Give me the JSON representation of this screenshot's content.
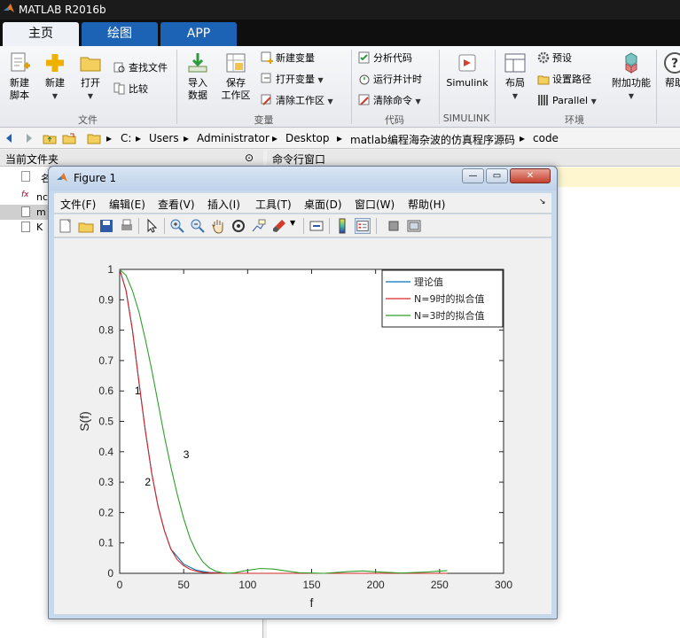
{
  "app": {
    "title": "MATLAB R2016b"
  },
  "ribbon_tabs": [
    "主页",
    "绘图",
    "APP"
  ],
  "ribbon": {
    "new_script": "新建\n脚本",
    "new": "新建",
    "open": "打开",
    "find_files": "查找文件",
    "compare": "比较",
    "import_data": "导入\n数据",
    "save_workspace": "保存\n工作区",
    "new_variable": "新建变量",
    "open_variable": "打开变量",
    "clear_workspace": "清除工作区",
    "analyze_code": "分析代码",
    "run_and_time": "运行并计时",
    "clear_commands": "清除命令",
    "simulink": "Simulink",
    "layout": "布局",
    "preferences": "预设",
    "set_path": "设置路径",
    "parallel": "Parallel",
    "addons": "附加功能",
    "help": "帮助",
    "groups": {
      "file": "文件",
      "variable": "变量",
      "code": "代码",
      "simulink": "SIMULINK",
      "environment": "环境"
    }
  },
  "address_bar": {
    "path": [
      "C:",
      "Users",
      "Administrator",
      "Desktop",
      "matlab编程海杂波的仿真程序源码",
      "code"
    ]
  },
  "current_folder": {
    "title": "当前文件夹",
    "name_header": "名",
    "files": [
      "nc",
      "m",
      "K"
    ]
  },
  "command_window": {
    "title": "命令行窗口"
  },
  "figure": {
    "title": "Figure 1",
    "menu": [
      "文件(F)",
      "编辑(E)",
      "查看(V)",
      "插入(I)",
      "工具(T)",
      "桌面(D)",
      "窗口(W)",
      "帮助(H)"
    ]
  },
  "chart_data": {
    "type": "line",
    "xlabel": "f",
    "ylabel": "S(f)",
    "xlim": [
      0,
      300
    ],
    "ylim": [
      0,
      1
    ],
    "xticks": [
      0,
      50,
      100,
      150,
      200,
      250,
      300
    ],
    "yticks": [
      0,
      0.1,
      0.2,
      0.3,
      0.4,
      0.5,
      0.6,
      0.7,
      0.8,
      0.9,
      1
    ],
    "legend_position": "top-right",
    "series": [
      {
        "name": "理论值",
        "color": "#0072bd",
        "x": [
          0,
          5,
          10,
          15,
          20,
          25,
          30,
          35,
          40,
          50,
          60,
          70,
          80,
          90,
          100,
          120,
          140,
          160,
          180,
          200,
          220,
          240,
          256
        ],
        "y": [
          1.0,
          0.93,
          0.8,
          0.63,
          0.47,
          0.33,
          0.22,
          0.14,
          0.08,
          0.03,
          0.01,
          0.003,
          0.001,
          0,
          0,
          0,
          0,
          0,
          0,
          0,
          0,
          0,
          0
        ]
      },
      {
        "name": "N=9时的拟合值",
        "color": "#d62728",
        "x": [
          0,
          5,
          10,
          15,
          20,
          25,
          30,
          35,
          40,
          45,
          50,
          55,
          60,
          65,
          70,
          75,
          80,
          90,
          100,
          120,
          140,
          160,
          180,
          200,
          220,
          240,
          256
        ],
        "y": [
          1.0,
          0.93,
          0.8,
          0.63,
          0.47,
          0.33,
          0.22,
          0.14,
          0.08,
          0.045,
          0.025,
          0.013,
          0.007,
          0.003,
          0.002,
          0.001,
          0,
          0,
          0,
          0,
          0,
          0,
          0,
          0,
          0,
          0,
          0
        ]
      },
      {
        "name": "N=3时的拟合值",
        "color": "#2ca02c",
        "x": [
          0,
          5,
          10,
          15,
          20,
          25,
          30,
          35,
          40,
          45,
          50,
          55,
          60,
          65,
          70,
          75,
          80,
          85,
          90,
          100,
          110,
          120,
          130,
          140,
          160,
          180,
          190,
          200,
          220,
          240,
          256
        ],
        "y": [
          1.0,
          0.98,
          0.93,
          0.86,
          0.77,
          0.67,
          0.56,
          0.45,
          0.35,
          0.26,
          0.18,
          0.115,
          0.07,
          0.038,
          0.018,
          0.007,
          0.002,
          0.0,
          0.002,
          0.01,
          0.016,
          0.014,
          0.008,
          0.002,
          0.0,
          0.006,
          0.008,
          0.005,
          0.001,
          0.004,
          0.009
        ]
      }
    ],
    "annotations": [
      {
        "text": "1",
        "x": 14,
        "y": 0.6
      },
      {
        "text": "2",
        "x": 22,
        "y": 0.3
      },
      {
        "text": "3",
        "x": 52,
        "y": 0.39
      }
    ]
  }
}
